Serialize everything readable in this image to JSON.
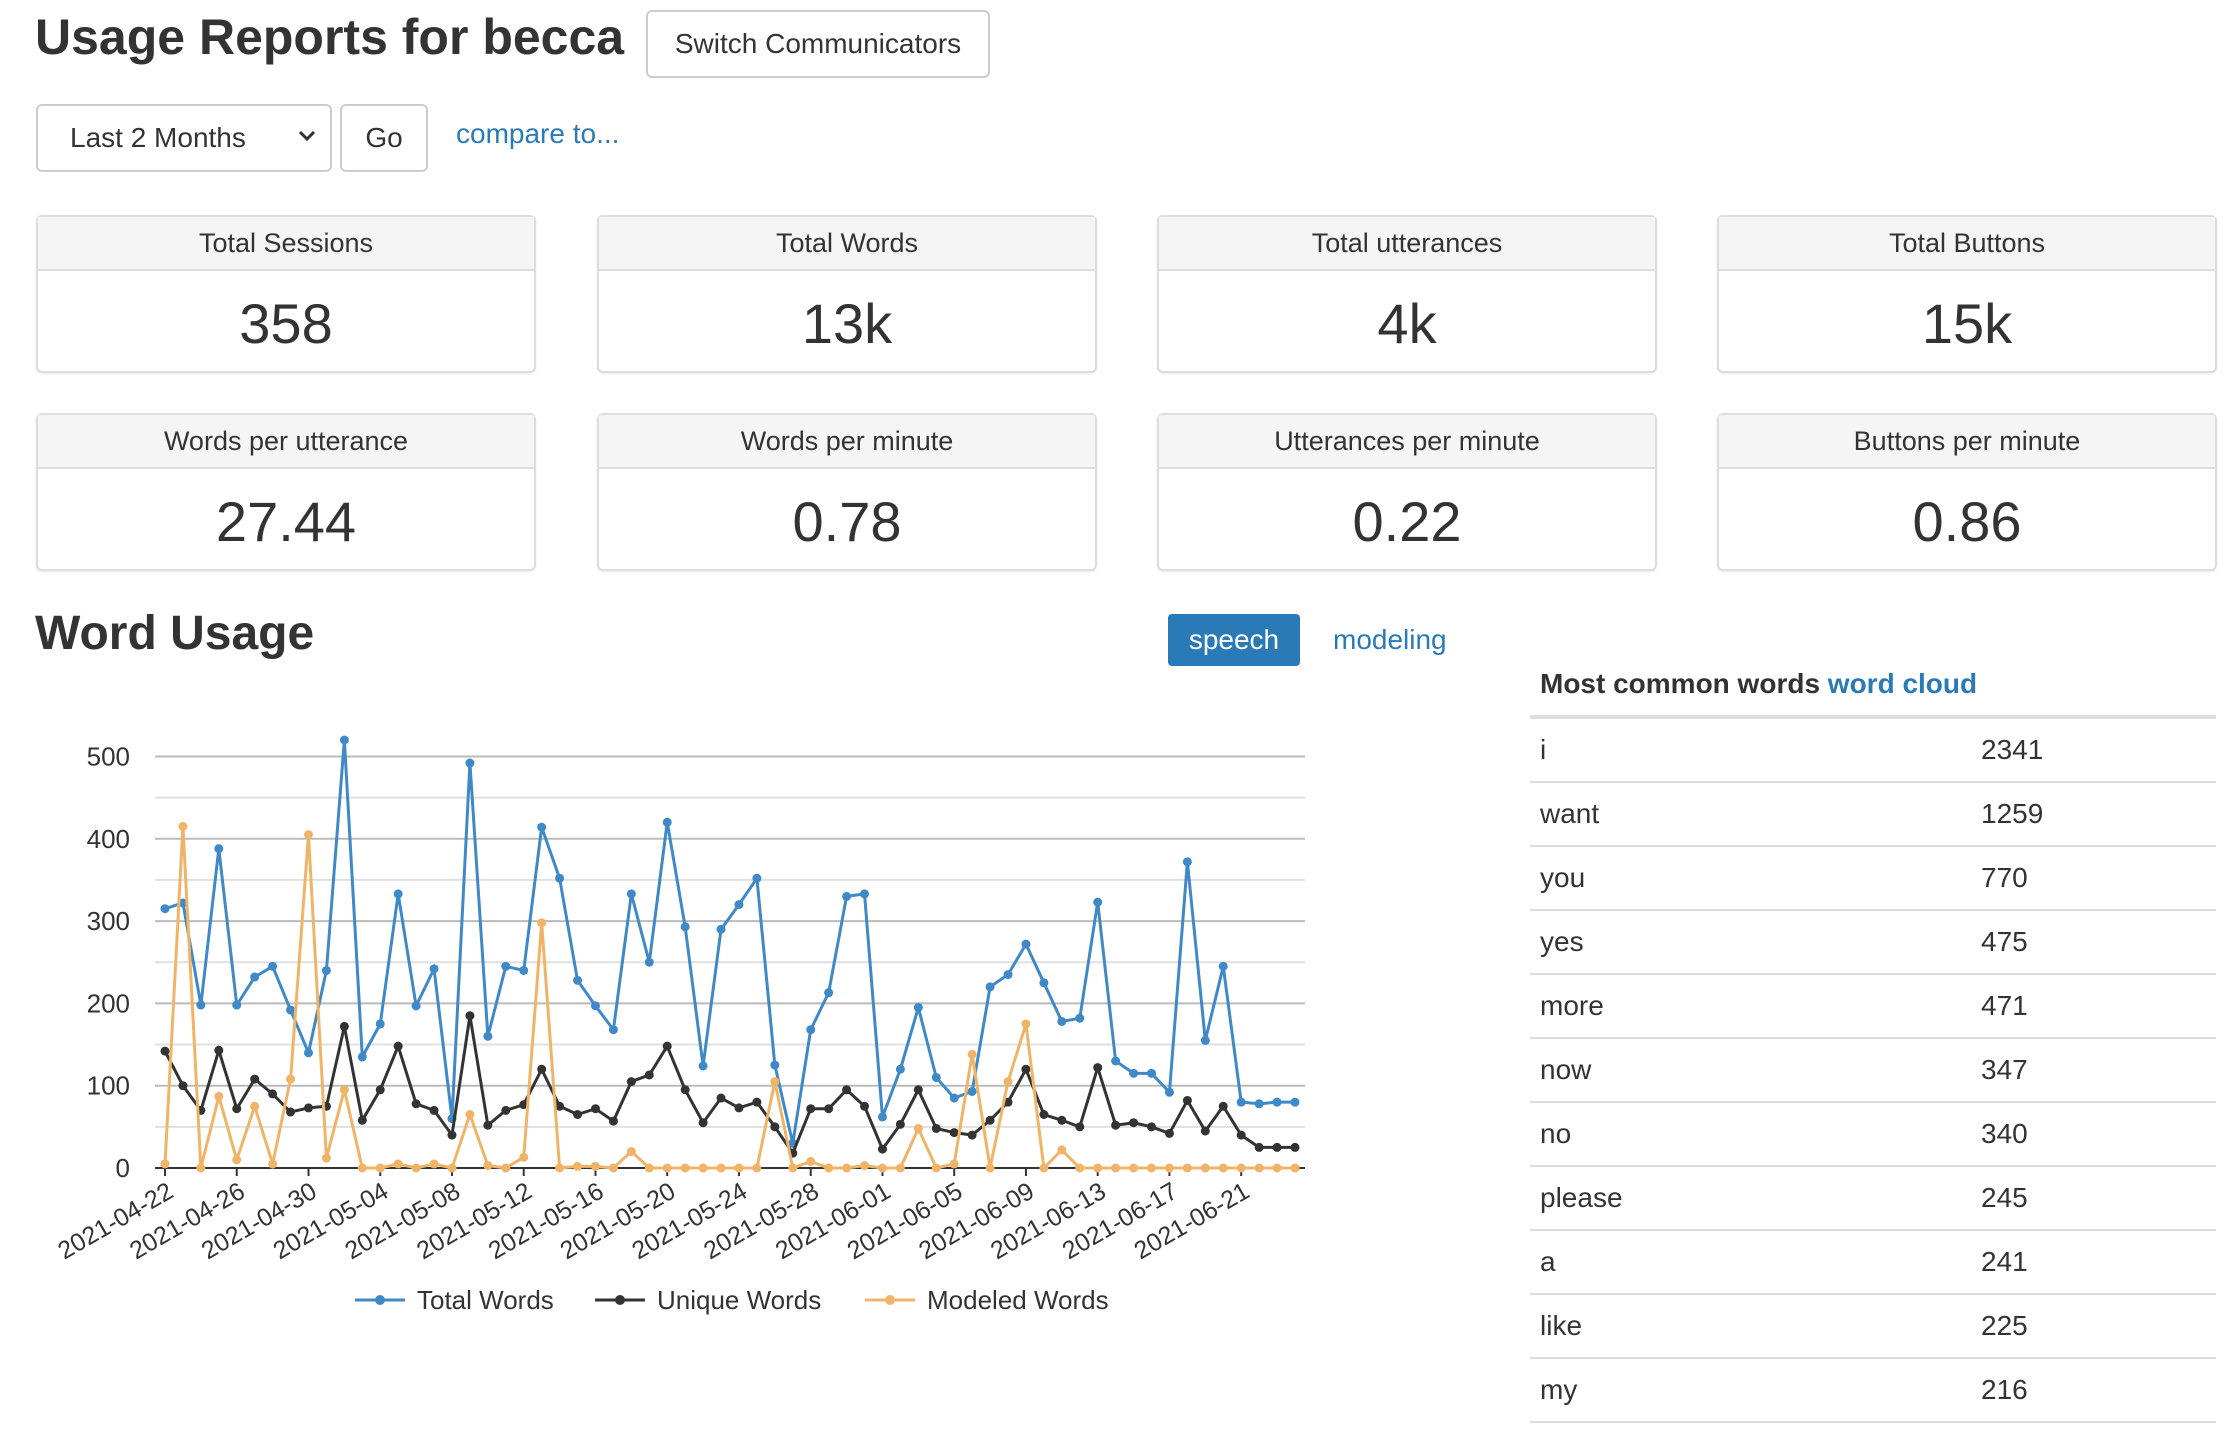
{
  "header": {
    "title": "Usage Reports for becca",
    "switch_label": "Switch Communicators"
  },
  "controls": {
    "range_value": "Last 2 Months",
    "go_label": "Go",
    "compare_label": "compare to..."
  },
  "stats": [
    {
      "label": "Total Sessions",
      "value": "358"
    },
    {
      "label": "Total Words",
      "value": "13k"
    },
    {
      "label": "Total utterances",
      "value": "4k"
    },
    {
      "label": "Total Buttons",
      "value": "15k"
    },
    {
      "label": "Words per utterance",
      "value": "27.44"
    },
    {
      "label": "Words per minute",
      "value": "0.78"
    },
    {
      "label": "Utterances per minute",
      "value": "0.22"
    },
    {
      "label": "Buttons per minute",
      "value": "0.86"
    }
  ],
  "word_usage": {
    "title": "Word Usage",
    "speech_label": "speech",
    "modeling_label": "modeling"
  },
  "common_words": {
    "title": "Most common words",
    "cloud_link": "word cloud",
    "rows": [
      {
        "word": "i",
        "count": "2341"
      },
      {
        "word": "want",
        "count": "1259"
      },
      {
        "word": "you",
        "count": "770"
      },
      {
        "word": "yes",
        "count": "475"
      },
      {
        "word": "more",
        "count": "471"
      },
      {
        "word": "now",
        "count": "347"
      },
      {
        "word": "no",
        "count": "340"
      },
      {
        "word": "please",
        "count": "245"
      },
      {
        "word": "a",
        "count": "241"
      },
      {
        "word": "like",
        "count": "225"
      },
      {
        "word": "my",
        "count": "216"
      }
    ]
  },
  "chart_data": {
    "type": "line",
    "x": [
      "2021-04-22",
      "2021-04-23",
      "2021-04-24",
      "2021-04-25",
      "2021-04-26",
      "2021-04-27",
      "2021-04-28",
      "2021-04-29",
      "2021-04-30",
      "2021-05-01",
      "2021-05-02",
      "2021-05-03",
      "2021-05-04",
      "2021-05-05",
      "2021-05-06",
      "2021-05-07",
      "2021-05-08",
      "2021-05-09",
      "2021-05-10",
      "2021-05-11",
      "2021-05-12",
      "2021-05-13",
      "2021-05-14",
      "2021-05-15",
      "2021-05-16",
      "2021-05-17",
      "2021-05-18",
      "2021-05-19",
      "2021-05-20",
      "2021-05-21",
      "2021-05-22",
      "2021-05-23",
      "2021-05-24",
      "2021-05-25",
      "2021-05-26",
      "2021-05-27",
      "2021-05-28",
      "2021-05-29",
      "2021-05-30",
      "2021-05-31",
      "2021-06-01",
      "2021-06-02",
      "2021-06-03",
      "2021-06-04",
      "2021-06-05",
      "2021-06-06",
      "2021-06-07",
      "2021-06-08",
      "2021-06-09",
      "2021-06-10",
      "2021-06-11",
      "2021-06-12",
      "2021-06-13",
      "2021-06-14",
      "2021-06-15",
      "2021-06-16",
      "2021-06-17",
      "2021-06-18",
      "2021-06-19",
      "2021-06-20",
      "2021-06-21",
      "2021-06-22",
      "2021-06-23",
      "2021-06-24"
    ],
    "x_tick_labels": [
      "2021-04-22",
      "2021-04-26",
      "2021-04-30",
      "2021-05-04",
      "2021-05-08",
      "2021-05-12",
      "2021-05-16",
      "2021-05-20",
      "2021-05-24",
      "2021-05-28",
      "2021-06-01",
      "2021-06-05",
      "2021-06-09",
      "2021-06-13",
      "2021-06-17",
      "2021-06-21"
    ],
    "y_ticks": [
      0,
      100,
      200,
      300,
      400,
      500
    ],
    "ylim": [
      0,
      520
    ],
    "grid": true,
    "legend_position": "bottom",
    "series": [
      {
        "name": "Total Words",
        "color": "#3f89c8",
        "values": [
          315,
          322,
          198,
          388,
          198,
          232,
          245,
          192,
          140,
          240,
          520,
          135,
          175,
          333,
          197,
          242,
          60,
          492,
          160,
          245,
          240,
          414,
          352,
          228,
          197,
          168,
          333,
          250,
          420,
          293,
          124,
          290,
          320,
          352,
          125,
          30,
          168,
          213,
          330,
          333,
          62,
          120,
          195,
          110,
          85,
          93,
          220,
          235,
          272,
          225,
          178,
          182,
          323,
          130,
          115,
          115,
          92,
          372,
          155,
          245,
          80,
          78,
          80,
          80
        ]
      },
      {
        "name": "Unique Words",
        "color": "#333333",
        "values": [
          142,
          100,
          70,
          143,
          72,
          108,
          90,
          68,
          73,
          75,
          172,
          58,
          95,
          148,
          78,
          70,
          40,
          185,
          52,
          70,
          77,
          120,
          75,
          65,
          72,
          57,
          105,
          113,
          148,
          95,
          55,
          85,
          73,
          80,
          50,
          18,
          72,
          72,
          95,
          75,
          23,
          53,
          95,
          48,
          43,
          40,
          58,
          80,
          120,
          65,
          58,
          50,
          122,
          52,
          55,
          50,
          42,
          82,
          45,
          75,
          40,
          25,
          25,
          25
        ]
      },
      {
        "name": "Modeled Words",
        "color": "#f0b468",
        "values": [
          5,
          415,
          0,
          87,
          10,
          75,
          5,
          108,
          405,
          12,
          95,
          0,
          0,
          5,
          0,
          5,
          0,
          65,
          3,
          0,
          13,
          298,
          0,
          2,
          2,
          0,
          20,
          0,
          0,
          0,
          0,
          0,
          0,
          0,
          105,
          0,
          8,
          0,
          0,
          3,
          0,
          0,
          48,
          0,
          5,
          138,
          0,
          105,
          175,
          0,
          22,
          0,
          0,
          0,
          0,
          0,
          0,
          0,
          0,
          0,
          0,
          0,
          0,
          0
        ]
      }
    ]
  }
}
